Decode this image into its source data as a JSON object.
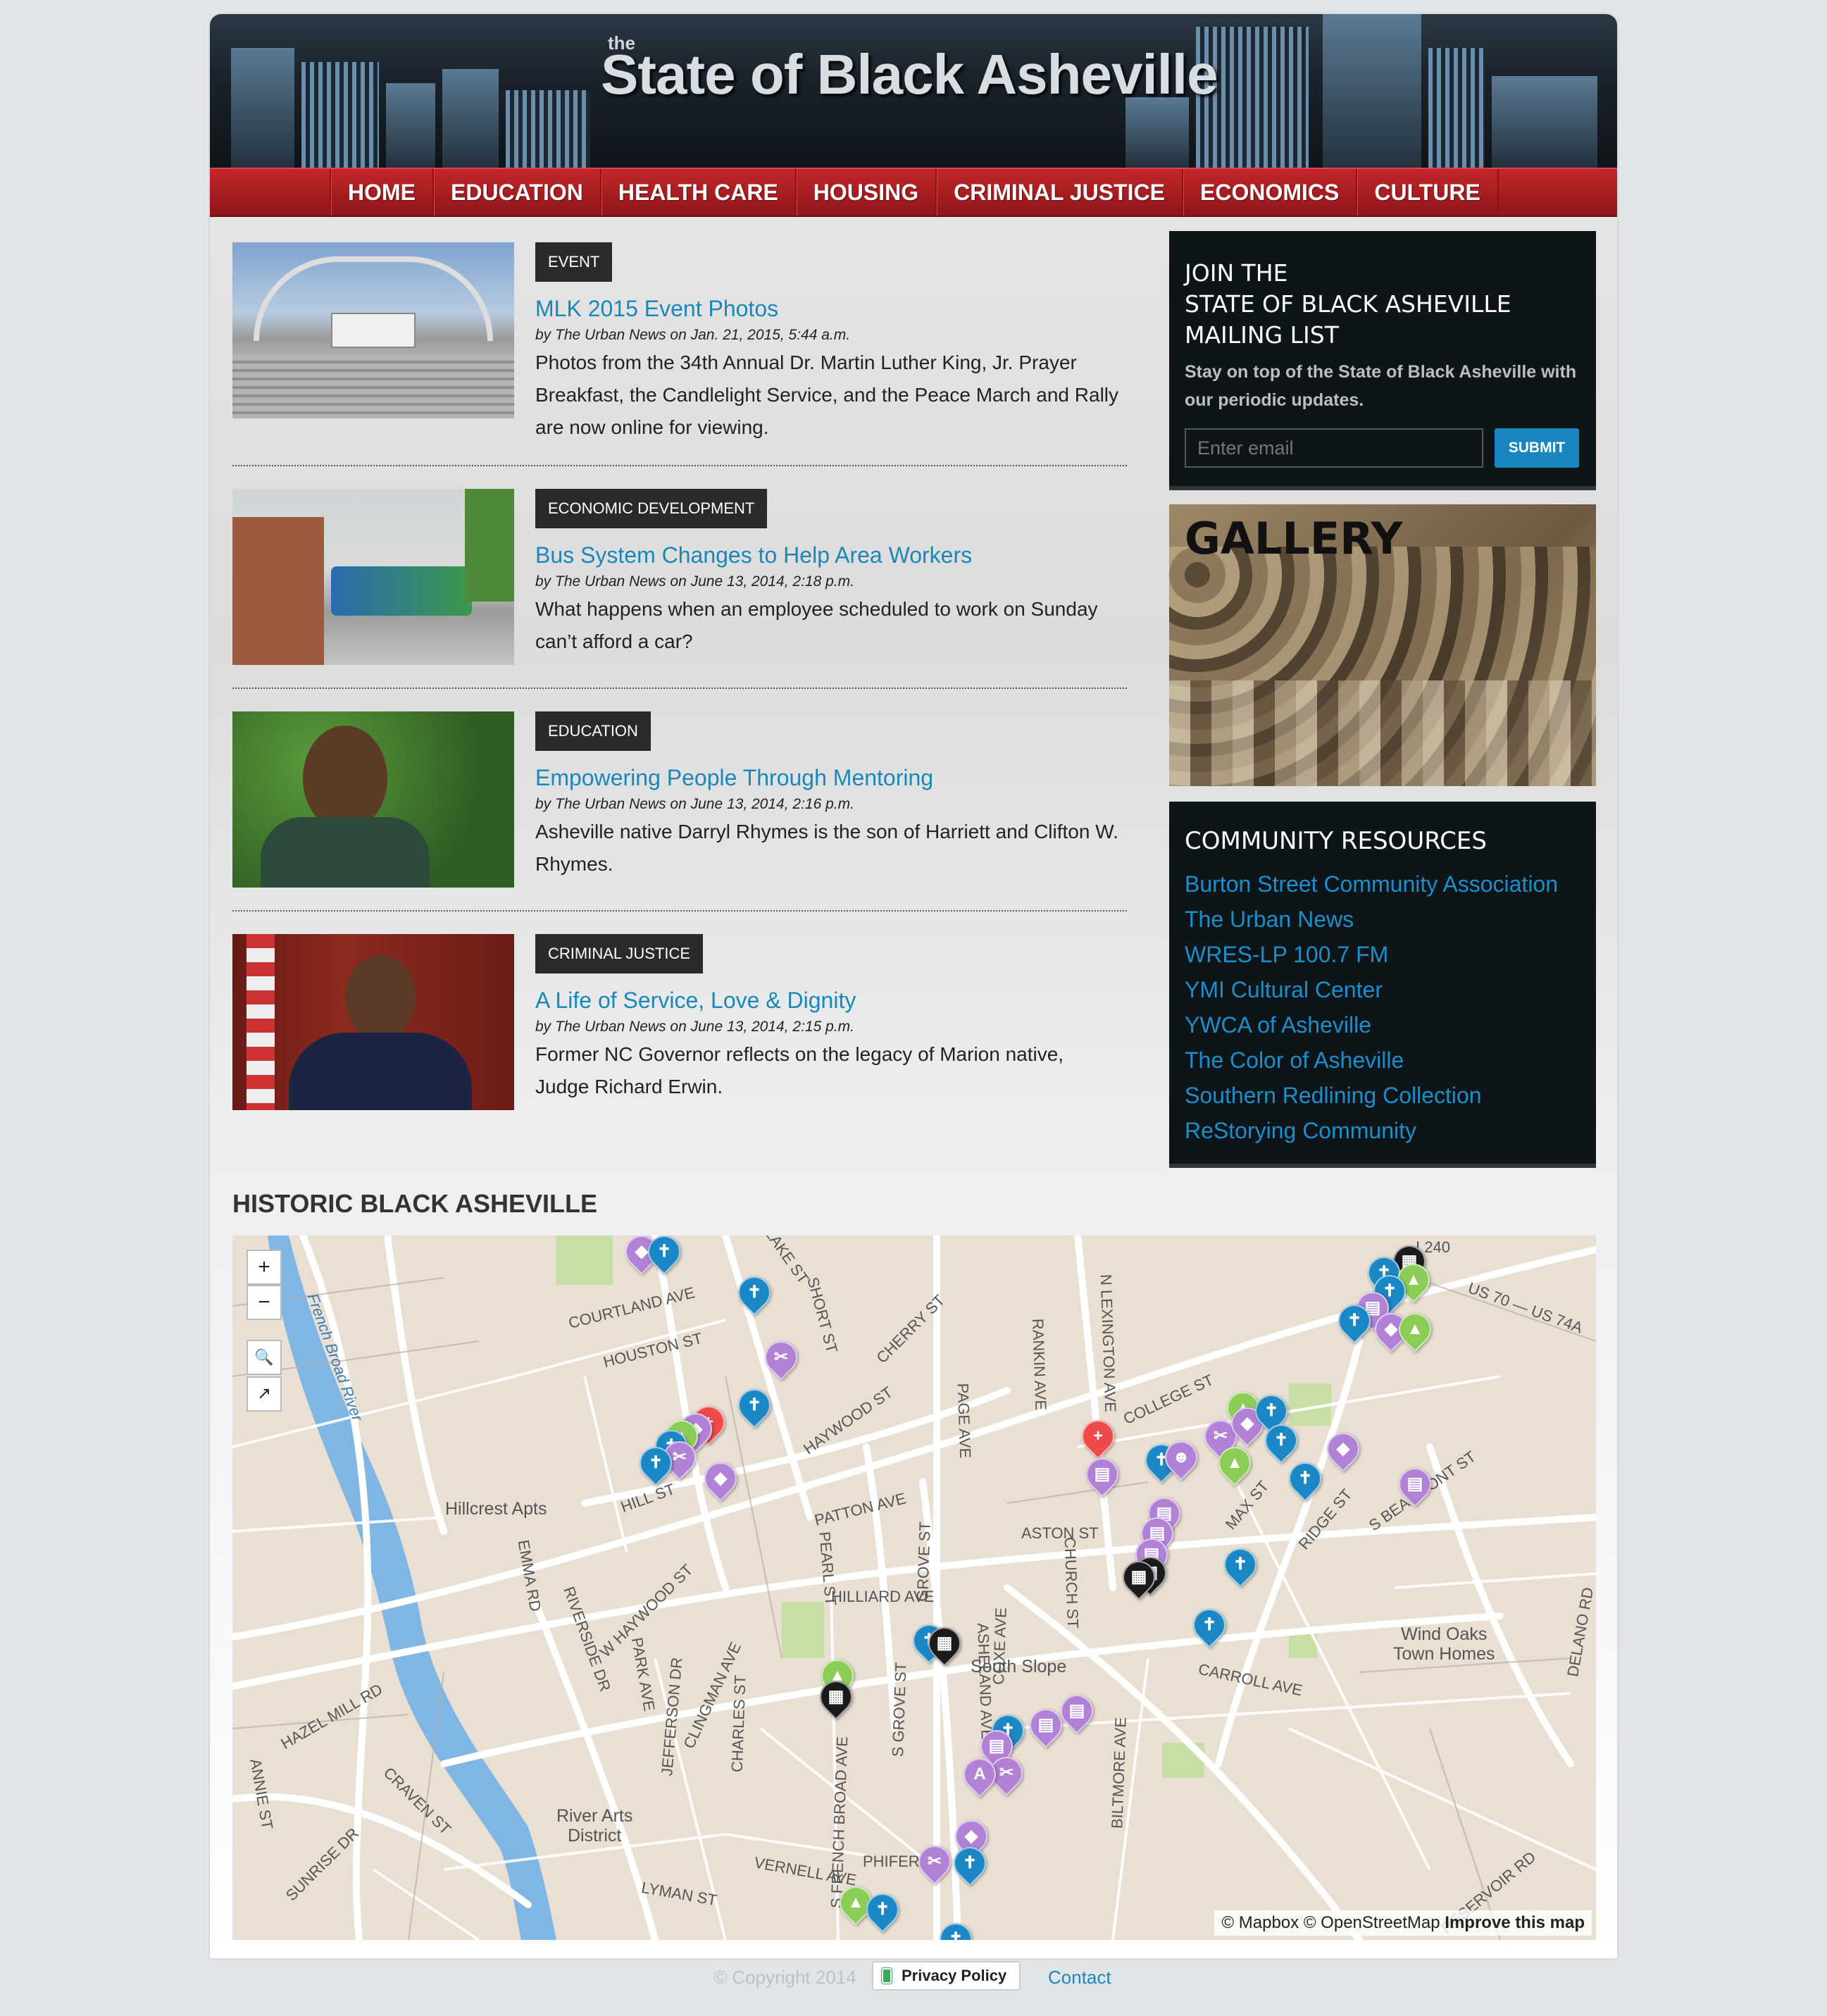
{
  "site": {
    "title_small": "the",
    "title": "State of Black Asheville"
  },
  "nav": [
    "HOME",
    "EDUCATION",
    "HEALTH CARE",
    "HOUSING",
    "CRIMINAL JUSTICE",
    "ECONOMICS",
    "CULTURE"
  ],
  "articles": [
    {
      "tag": "EVENT",
      "headline": "MLK 2015 Event Photos",
      "byline": "by The Urban News on Jan. 21, 2015, 5:44 a.m.",
      "summary": "Photos from the 34th Annual Dr. Martin Luther King, Jr. Prayer Breakfast, the Candlelight Service, and the Peace March and Rally are now online for viewing."
    },
    {
      "tag": "ECONOMIC DEVELOPMENT",
      "headline": "Bus System Changes to Help Area Workers",
      "byline": "by The Urban News on June 13, 2014, 2:18 p.m.",
      "summary": "What happens when an employee scheduled to work on Sunday can’t afford a car?"
    },
    {
      "tag": "EDUCATION",
      "headline": "Empowering People Through Mentoring",
      "byline": "by The Urban News on June 13, 2014, 2:16 p.m.",
      "summary": "Asheville native Darryl Rhymes is the son of Harriett and Clifton W. Rhymes."
    },
    {
      "tag": "CRIMINAL JUSTICE",
      "headline": "A Life of Service, Love & Dignity",
      "byline": "by The Urban News on June 13, 2014, 2:15 p.m.",
      "summary": "Former NC Governor reflects on the legacy of Marion native, Judge Richard Erwin."
    }
  ],
  "mailing": {
    "heading": "JOIN THE\nSTATE OF BLACK ASHEVILLE\nMAILING LIST",
    "description": "Stay on top of the State of Black Asheville with our periodic updates.",
    "placeholder": "Enter email",
    "submit": "SUBMIT"
  },
  "gallery": {
    "title": "GALLERY"
  },
  "resources": {
    "heading": "COMMUNITY RESOURCES",
    "links": [
      "Burton Street Community Association",
      "The Urban News",
      "WRES-LP 100.7 FM",
      "YMI Cultural Center",
      "YWCA of Asheville",
      "The Color of Asheville",
      "Southern Redlining Collection",
      "ReStorying Community"
    ]
  },
  "map": {
    "title": "HISTORIC BLACK ASHEVILLE",
    "zoom_in": "+",
    "zoom_out": "−",
    "places": [
      "Hillcrest Apts",
      "South Slope",
      "River Arts\nDistrict",
      "Wind Oaks\nTown Homes"
    ],
    "streets": [
      "COURTLAND AVE",
      "HOUSTON ST",
      "HILL ST",
      "PATTON AVE",
      "HILLIARD AVE",
      "HAYWOOD ST",
      "EMMA RD",
      "RIVERSIDE DR",
      "COLLEGE ST",
      "ASTON ST",
      "CHURCH ST",
      "BILTMORE AVE",
      "CARROLL AVE",
      "CLINGMAN AVE",
      "LYMAN ST",
      "PHIFER ST",
      "HAZEL MILL RD",
      "MAX ST",
      "RIDGE ST",
      "DELANO RD",
      "I 240",
      "US 70 — US 74A",
      "French Broad River",
      "COXE AVE",
      "PAGE AVE",
      "ASHELAND AVE",
      "GROVE ST",
      "PEARL ST",
      "SHORT ST",
      "BLAKE ST",
      "CHERRY ST",
      "N LEXINGTON AVE",
      "RANKIN AVE",
      "JEFFERSON DR",
      "PARK AVE",
      "S FRENCH BROAD AVE",
      "CHARLES ST",
      "W HAYWOOD ST",
      "CRAVEN ST",
      "SUNRISE DR",
      "VERNELL AVE",
      "ANNIE ST",
      "S BEAUMONT ST",
      "S GROVE ST",
      "RESERVOIR RD"
    ],
    "attribution": [
      "© Mapbox",
      "© OpenStreetMap",
      "Improve this map"
    ]
  },
  "footer": {
    "copyright": "© Copyright 2014",
    "privacy": "Privacy Policy",
    "contact": "Contact"
  },
  "colors": {
    "nav_red": "#b21f23",
    "link_blue": "#1b87b9",
    "box_dark": "#0e1518",
    "pin_blue": "#1b87c4",
    "pin_purple": "#b181d6",
    "pin_green": "#8ccd57",
    "pin_black": "#1b1b1b",
    "pin_red": "#ee4a4a"
  }
}
